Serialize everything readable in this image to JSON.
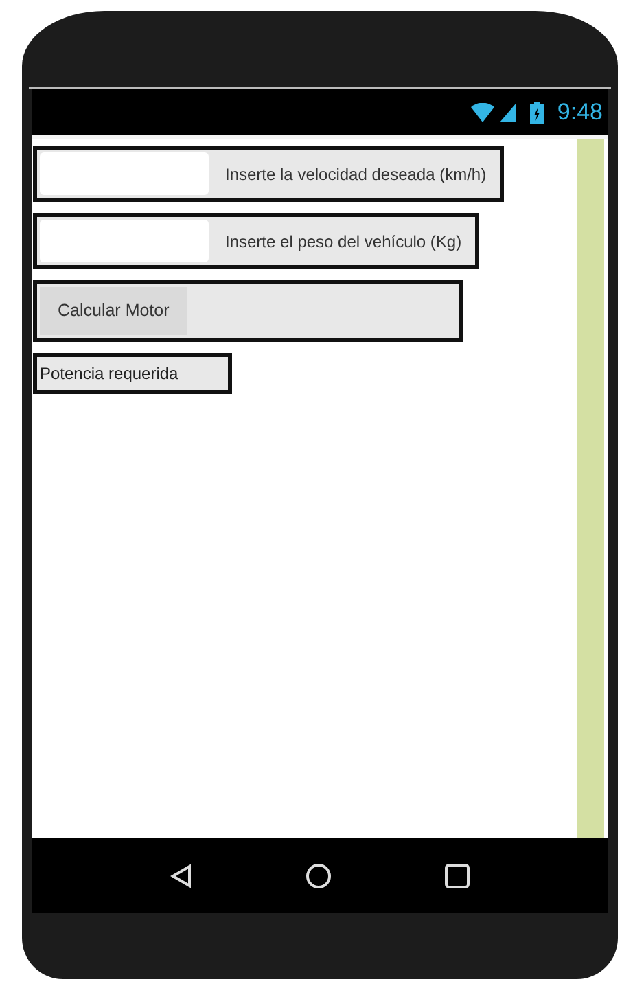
{
  "status_bar": {
    "time": "9:48"
  },
  "inputs": [
    {
      "label": "Inserte la velocidad deseada (km/h)"
    },
    {
      "label": "Inserte el peso del vehículo (Kg)"
    }
  ],
  "button": {
    "label": "Calcular Motor"
  },
  "result_label": {
    "text": "Potencia requerida"
  }
}
